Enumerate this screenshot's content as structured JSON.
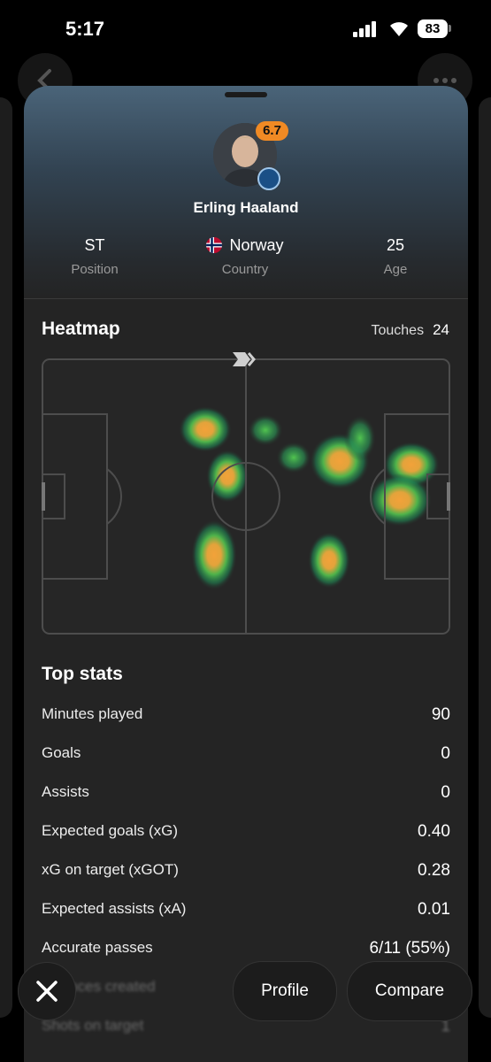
{
  "status": {
    "time": "5:17",
    "battery": "83"
  },
  "player": {
    "name": "Erling Haaland",
    "rating": "6.7"
  },
  "info": [
    {
      "value": "ST",
      "label": "Position"
    },
    {
      "value": "Norway",
      "label": "Country"
    },
    {
      "value": "25",
      "label": "Age"
    }
  ],
  "heatmap": {
    "title": "Heatmap",
    "touches_label": "Touches",
    "touches_value": "24"
  },
  "top_stats": {
    "title": "Top stats",
    "rows": [
      {
        "label": "Minutes played",
        "value": "90"
      },
      {
        "label": "Goals",
        "value": "0"
      },
      {
        "label": "Assists",
        "value": "0"
      },
      {
        "label": "Expected goals (xG)",
        "value": "0.40"
      },
      {
        "label": "xG on target (xGOT)",
        "value": "0.28"
      },
      {
        "label": "Expected assists (xA)",
        "value": "0.01"
      },
      {
        "label": "Accurate passes",
        "value": "6/11 (55%)"
      },
      {
        "label": "Chances created",
        "value": "0"
      },
      {
        "label": "Shots on target",
        "value": "1"
      }
    ]
  },
  "buttons": {
    "profile": "Profile",
    "compare": "Compare"
  },
  "colors": {
    "rating_badge": "#f08a24",
    "sheet_top": "#4a6479",
    "sheet_body": "#242424"
  },
  "icons": [
    "back-arrow-icon",
    "more-options-icon",
    "close-icon",
    "attack-direction-icon",
    "club-crest-icon",
    "norway-flag-icon"
  ]
}
